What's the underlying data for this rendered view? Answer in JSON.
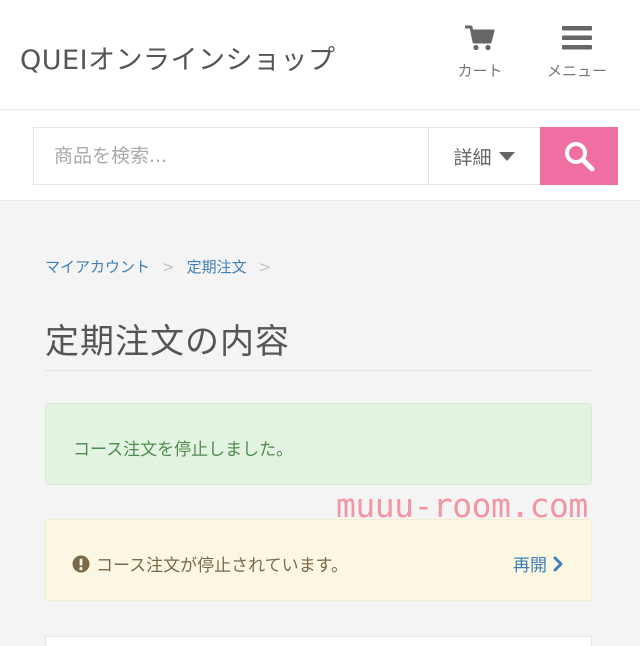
{
  "header": {
    "shop_title": "QUEIオンラインショップ",
    "cart_label": "カート",
    "menu_label": "メニュー"
  },
  "search": {
    "placeholder": "商品を検索...",
    "detail_label": "詳細"
  },
  "breadcrumb": {
    "items": [
      "マイアカウント",
      "定期注文"
    ],
    "separator": ">"
  },
  "page": {
    "title": "定期注文の内容"
  },
  "alerts": {
    "success_message": "コース注文を停止しました。",
    "warning_message": "コース注文が停止されています。",
    "resume_label": "再開"
  },
  "watermark": "muuu-room.com",
  "colors": {
    "accent_pink": "#ef6fa3",
    "link_blue": "#3f7fb5",
    "success_bg": "#e3f3e1",
    "warning_bg": "#fcf7e3"
  },
  "icons": {
    "cart": "cart-icon",
    "menu": "hamburger-icon",
    "search": "search-icon",
    "caret": "caret-down-icon",
    "info": "exclamation-circle-icon",
    "chevron": "chevron-right-icon"
  }
}
